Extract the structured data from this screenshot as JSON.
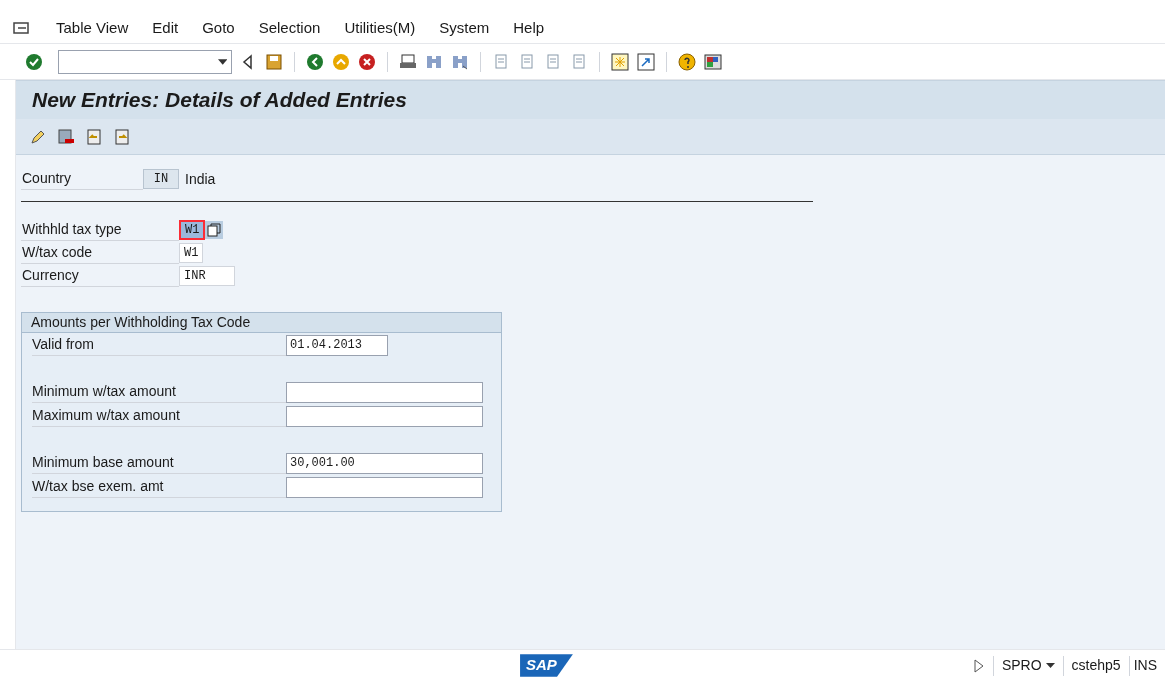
{
  "menu_bar": {
    "items": [
      "Table View",
      "Edit",
      "Goto",
      "Selection",
      "Utilities(M)",
      "System",
      "Help"
    ]
  },
  "title": "New Entries: Details of Added Entries",
  "header_fields": [
    {
      "label": "Country",
      "value": "IN",
      "kind": "display",
      "description": "India"
    }
  ],
  "key_fields": [
    {
      "label": "Withhld tax type",
      "value": "W1",
      "focused": true,
      "has_value_help": true
    },
    {
      "label": "W/tax code",
      "value": "W1",
      "focused": false,
      "has_value_help": false
    },
    {
      "label": "Currency",
      "value": "INR",
      "focused": false,
      "has_value_help": false
    }
  ],
  "group_box": {
    "title": "Amounts per Withholding Tax Code",
    "sections": [
      [
        {
          "label": "Valid from",
          "value": "01.04.2013",
          "kind": "date"
        }
      ],
      [
        {
          "label": "Minimum w/tax amount",
          "kind": "amount"
        },
        {
          "label": "Maximum w/tax amount",
          "kind": "amount"
        }
      ],
      [
        {
          "label": "Minimum base amount",
          "value": "30,001.00",
          "kind": "amount"
        },
        {
          "label": "W/tax bse exem. amt",
          "kind": "amount"
        }
      ]
    ]
  },
  "status_bar": {
    "logo": "SAP",
    "transaction": "SPRO",
    "system": "cstehp5",
    "mode": "INS"
  }
}
